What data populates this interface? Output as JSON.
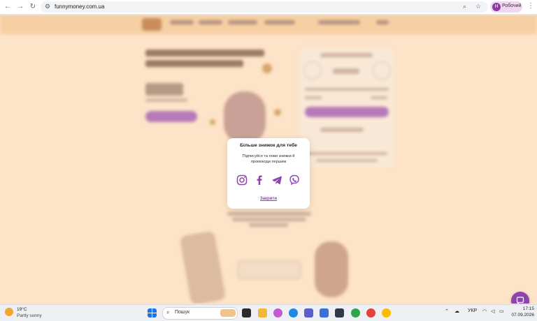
{
  "browser": {
    "url": "funnymoney.com.ua",
    "profile_initial": "Н",
    "profile_name": "Робочий",
    "back_icon": "arrow-left-icon",
    "forward_icon": "arrow-right-icon",
    "reload_icon": "reload-icon"
  },
  "modal": {
    "title": "Більше знижок для тебе",
    "subtitle": "Підписуйся та лови знижки й промокоди першим",
    "social_icons": [
      "instagram-icon",
      "facebook-icon",
      "telegram-icon",
      "viber-icon"
    ],
    "close_label": "Закрити"
  },
  "colors": {
    "accent": "#8e44ad",
    "page_bg": "#fde3c7",
    "modal_bg": "#ffffff"
  },
  "taskbar": {
    "weather_temp": "19°C",
    "weather_desc": "Partly sunny",
    "search_placeholder": "Пошук",
    "language": "УКР",
    "time": "17:15",
    "date": "07.09.2026"
  }
}
